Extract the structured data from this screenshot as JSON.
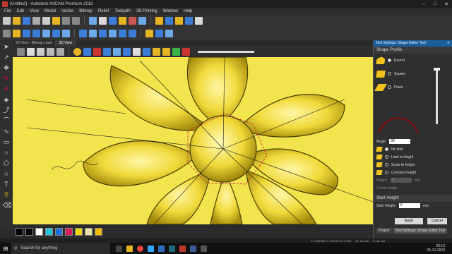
{
  "titlebar": {
    "title": "(Untitled) - Autodesk ArtCAM Premium 2018"
  },
  "menu": [
    "File",
    "Edit",
    "View",
    "Model",
    "Vector",
    "Bitmap",
    "Relief",
    "Toolpath",
    "3D Printing",
    "Window",
    "Help"
  ],
  "tabs": [
    "2D View - Bitmap Layer",
    "3D View"
  ],
  "panel": {
    "title": "Tool Settings: Shape Editor Tool",
    "shape_profile_heading": "Shape Profile",
    "profiles": [
      "Round",
      "Square",
      "Plane"
    ],
    "angle_label": "Angle:",
    "angle_value": "90",
    "height_options": [
      "No limit",
      "Limit to height",
      "Scale to height",
      "Constant height"
    ],
    "height_label": "Height:",
    "height_value": "0",
    "height_unit": "mm",
    "corner_angle_label": "Corner Angle",
    "start_height_heading": "Start Height",
    "start_height_label": "Start Height:",
    "start_height_value": "0",
    "start_height_unit": "mm",
    "apply_label": "Apply",
    "cancel_label": "Cancel",
    "bottom_tabs": [
      "Project",
      "Tool Settings: Shape Editor Tool"
    ]
  },
  "status": {
    "coords": "X: 1335.893  Y: 630.021  Z: 0.000",
    "width": "W: 46.444",
    "height": "H: 46.444"
  },
  "taskbar": {
    "search_placeholder": "Search for anything",
    "time": "23:13",
    "date": "05-12-2020"
  },
  "swatches": [
    "#000000",
    "#ffffff",
    "#1ec6d9",
    "#1e6fd9",
    "#d81e5b",
    "#f2d600",
    "#e9e3a6",
    "#f2b800"
  ],
  "colors": {
    "accent": "#1b5e9c",
    "relief": "#f2e44c",
    "relief_shadow": "#b39d12"
  }
}
